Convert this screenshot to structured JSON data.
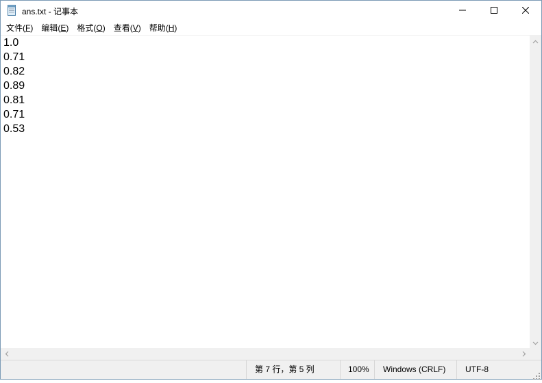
{
  "window": {
    "title": "ans.txt - 记事本",
    "controls": {
      "minimize": "minimize-icon",
      "maximize": "maximize-icon",
      "close": "close-icon"
    }
  },
  "menu": {
    "items": [
      {
        "label": "文件(",
        "key": "F",
        "end": ")"
      },
      {
        "label": "编辑(",
        "key": "E",
        "end": ")"
      },
      {
        "label": "格式(",
        "key": "O",
        "end": ")"
      },
      {
        "label": "查看(",
        "key": "V",
        "end": ")"
      },
      {
        "label": "帮助(",
        "key": "H",
        "end": ")"
      }
    ]
  },
  "editor": {
    "lines": [
      "1.0",
      "0.71",
      "0.82",
      "0.89",
      "0.81",
      "0.71",
      "0.53"
    ]
  },
  "status": {
    "position": "第 7 行，第 5 列",
    "zoom": "100%",
    "line_ending": "Windows (CRLF)",
    "encoding": "UTF-8"
  },
  "colors": {
    "window_border": "#7a9ab5",
    "statusbar_bg": "#f0f0f0",
    "scrollbar_bg": "#f0f0f0",
    "text": "#000000"
  }
}
